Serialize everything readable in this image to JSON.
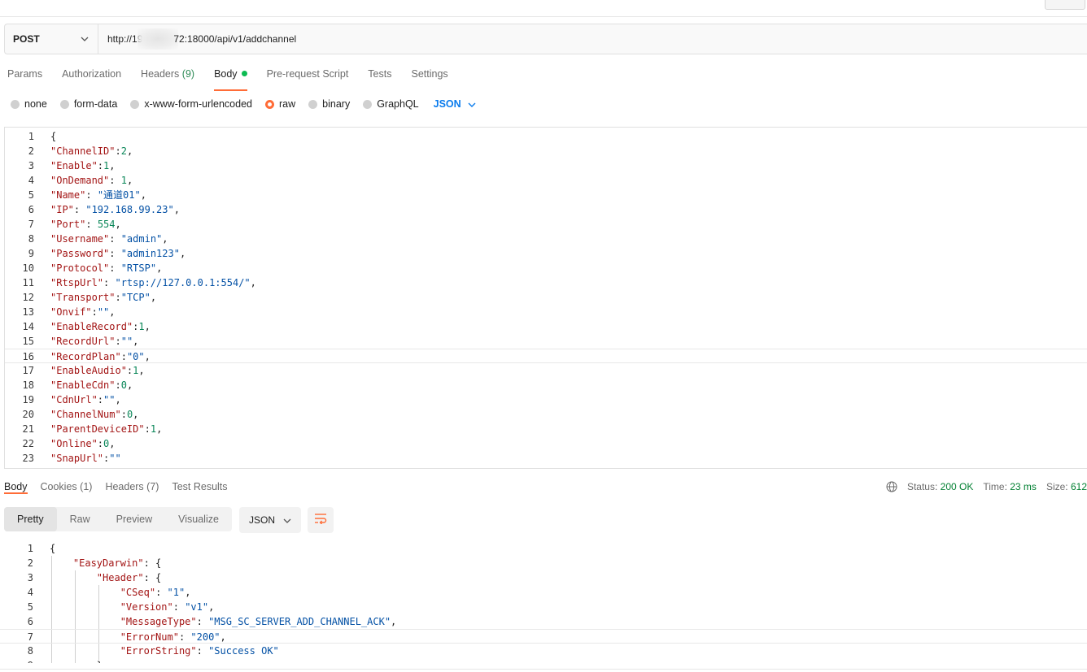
{
  "request": {
    "method": "POST",
    "url_prefix": "http://19",
    "url_suffix": "72:18000/api/v1/addchannel"
  },
  "request_tabs": [
    {
      "label": "Params"
    },
    {
      "label": "Authorization"
    },
    {
      "label": "Headers",
      "count": "(9)"
    },
    {
      "label": "Body",
      "active": true
    },
    {
      "label": "Pre-request Script"
    },
    {
      "label": "Tests"
    },
    {
      "label": "Settings"
    }
  ],
  "body_types": [
    "none",
    "form-data",
    "x-www-form-urlencoded",
    "raw",
    "binary",
    "GraphQL"
  ],
  "body_type_selected": "raw",
  "body_format": "JSON",
  "request_body_lines": [
    [
      [
        "p",
        "{"
      ]
    ],
    [
      [
        "k",
        "\"ChannelID\""
      ],
      [
        "p",
        ":"
      ],
      [
        "n",
        "2"
      ],
      [
        "p",
        ","
      ]
    ],
    [
      [
        "k",
        "\"Enable\""
      ],
      [
        "p",
        ":"
      ],
      [
        "n",
        "1"
      ],
      [
        "p",
        ","
      ]
    ],
    [
      [
        "k",
        "\"OnDemand\""
      ],
      [
        "p",
        ": "
      ],
      [
        "n",
        "1"
      ],
      [
        "p",
        ","
      ]
    ],
    [
      [
        "k",
        "\"Name\""
      ],
      [
        "p",
        ": "
      ],
      [
        "s",
        "\"通道01\""
      ],
      [
        "p",
        ","
      ]
    ],
    [
      [
        "k",
        "\"IP\""
      ],
      [
        "p",
        ": "
      ],
      [
        "s",
        "\"192.168.99.23\""
      ],
      [
        "p",
        ","
      ]
    ],
    [
      [
        "k",
        "\"Port\""
      ],
      [
        "p",
        ": "
      ],
      [
        "n",
        "554"
      ],
      [
        "p",
        ","
      ]
    ],
    [
      [
        "k",
        "\"Username\""
      ],
      [
        "p",
        ": "
      ],
      [
        "s",
        "\"admin\""
      ],
      [
        "p",
        ","
      ]
    ],
    [
      [
        "k",
        "\"Password\""
      ],
      [
        "p",
        ": "
      ],
      [
        "s",
        "\"admin123\""
      ],
      [
        "p",
        ","
      ]
    ],
    [
      [
        "k",
        "\"Protocol\""
      ],
      [
        "p",
        ": "
      ],
      [
        "s",
        "\"RTSP\""
      ],
      [
        "p",
        ","
      ]
    ],
    [
      [
        "k",
        "\"RtspUrl\""
      ],
      [
        "p",
        ": "
      ],
      [
        "s",
        "\"rtsp://127.0.0.1:554/\""
      ],
      [
        "p",
        ","
      ]
    ],
    [
      [
        "k",
        "\"Transport\""
      ],
      [
        "p",
        ":"
      ],
      [
        "s",
        "\"TCP\""
      ],
      [
        "p",
        ","
      ]
    ],
    [
      [
        "k",
        "\"Onvif\""
      ],
      [
        "p",
        ":"
      ],
      [
        "s",
        "\"\""
      ],
      [
        "p",
        ","
      ]
    ],
    [
      [
        "k",
        "\"EnableRecord\""
      ],
      [
        "p",
        ":"
      ],
      [
        "n",
        "1"
      ],
      [
        "p",
        ","
      ]
    ],
    [
      [
        "k",
        "\"RecordUrl\""
      ],
      [
        "p",
        ":"
      ],
      [
        "s",
        "\"\""
      ],
      [
        "p",
        ","
      ]
    ],
    [
      [
        "k",
        "\"RecordPlan\""
      ],
      [
        "p",
        ":"
      ],
      [
        "s",
        "\"0\""
      ],
      [
        "p",
        ","
      ]
    ],
    [
      [
        "k",
        "\"EnableAudio\""
      ],
      [
        "p",
        ":"
      ],
      [
        "n",
        "1"
      ],
      [
        "p",
        ","
      ]
    ],
    [
      [
        "k",
        "\"EnableCdn\""
      ],
      [
        "p",
        ":"
      ],
      [
        "n",
        "0"
      ],
      [
        "p",
        ","
      ]
    ],
    [
      [
        "k",
        "\"CdnUrl\""
      ],
      [
        "p",
        ":"
      ],
      [
        "s",
        "\"\""
      ],
      [
        "p",
        ","
      ]
    ],
    [
      [
        "k",
        "\"ChannelNum\""
      ],
      [
        "p",
        ":"
      ],
      [
        "n",
        "0"
      ],
      [
        "p",
        ","
      ]
    ],
    [
      [
        "k",
        "\"ParentDeviceID\""
      ],
      [
        "p",
        ":"
      ],
      [
        "n",
        "1"
      ],
      [
        "p",
        ","
      ]
    ],
    [
      [
        "k",
        "\"Online\""
      ],
      [
        "p",
        ":"
      ],
      [
        "n",
        "0"
      ],
      [
        "p",
        ","
      ]
    ],
    [
      [
        "k",
        "\"SnapUrl\""
      ],
      [
        "p",
        ":"
      ],
      [
        "s",
        "\"\""
      ]
    ]
  ],
  "response_tabs": [
    {
      "label": "Body",
      "active": true
    },
    {
      "label": "Cookies",
      "count": "(1)"
    },
    {
      "label": "Headers",
      "count": "(7)"
    },
    {
      "label": "Test Results"
    }
  ],
  "response_status": {
    "status_label": "Status:",
    "status_value": "200 OK",
    "time_label": "Time:",
    "time_value": "23 ms",
    "size_label": "Size:",
    "size_value": "612"
  },
  "response_views": [
    "Pretty",
    "Raw",
    "Preview",
    "Visualize"
  ],
  "response_view_selected": "Pretty",
  "response_format": "JSON",
  "response_body_lines": [
    [
      [
        "p",
        "{"
      ]
    ],
    [
      [
        "p",
        "    "
      ],
      [
        "k",
        "\"EasyDarwin\""
      ],
      [
        "p",
        ": {"
      ]
    ],
    [
      [
        "p",
        "        "
      ],
      [
        "k",
        "\"Header\""
      ],
      [
        "p",
        ": {"
      ]
    ],
    [
      [
        "p",
        "            "
      ],
      [
        "k",
        "\"CSeq\""
      ],
      [
        "p",
        ": "
      ],
      [
        "s",
        "\"1\""
      ],
      [
        "p",
        ","
      ]
    ],
    [
      [
        "p",
        "            "
      ],
      [
        "k",
        "\"Version\""
      ],
      [
        "p",
        ": "
      ],
      [
        "s",
        "\"v1\""
      ],
      [
        "p",
        ","
      ]
    ],
    [
      [
        "p",
        "            "
      ],
      [
        "k",
        "\"MessageType\""
      ],
      [
        "p",
        ": "
      ],
      [
        "s",
        "\"MSG_SC_SERVER_ADD_CHANNEL_ACK\""
      ],
      [
        "p",
        ","
      ]
    ],
    [
      [
        "p",
        "            "
      ],
      [
        "k",
        "\"ErrorNum\""
      ],
      [
        "p",
        ": "
      ],
      [
        "s",
        "\"200\""
      ],
      [
        "p",
        ","
      ]
    ],
    [
      [
        "p",
        "            "
      ],
      [
        "k",
        "\"ErrorString\""
      ],
      [
        "p",
        ": "
      ],
      [
        "s",
        "\"Success OK\""
      ]
    ],
    [
      [
        "p",
        "        },"
      ]
    ]
  ]
}
